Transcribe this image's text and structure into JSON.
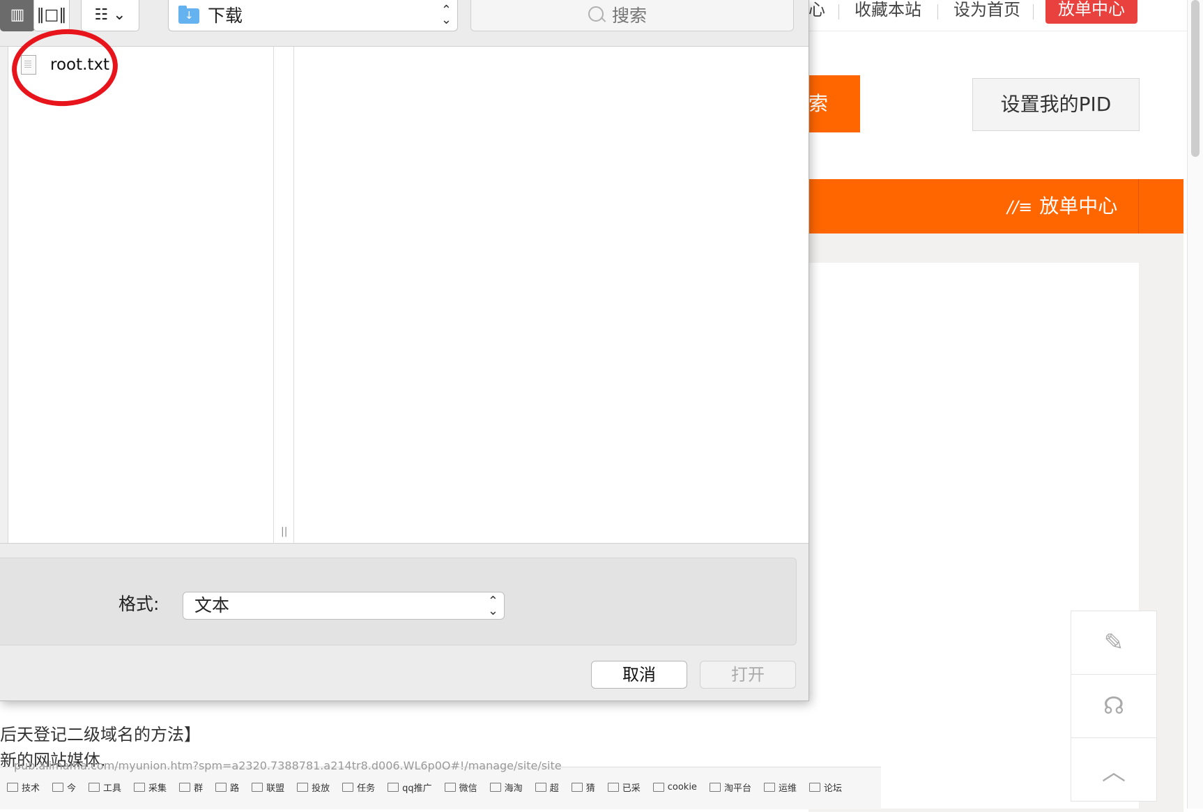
{
  "web": {
    "top_nav": [
      "心",
      "收藏本站",
      "设为首页"
    ],
    "top_red_button": "放单中心",
    "search_button_fragment": "索",
    "pid_button": "设置我的PID",
    "orange_bar_item": "放单中心",
    "bottom_lines": [
      "后天登记二级域名的方法】",
      "新的网站媒体."
    ],
    "url_text": "pub.alimama.com/myunion.htm?spm=a2320.7388781.a214tr8.d006.WL6p0O#!/manage/site/site",
    "bookmarks": [
      "技术",
      "今",
      "工具",
      "采集",
      "群",
      "路",
      "联盟",
      "投放",
      "任务",
      "qq推广",
      "微信",
      "海淘",
      "超",
      "猜",
      "已采",
      "cookie",
      "淘平台",
      "运维",
      "论坛"
    ],
    "colors": {
      "orange": "#ff6600",
      "red": "#e8413e"
    }
  },
  "dialog": {
    "location": "下载",
    "search_placeholder": "搜索",
    "files": [
      "root.txt"
    ],
    "format_label": "格式:",
    "format_value": "文本",
    "cancel_label": "取消",
    "open_label": "打开",
    "icons": [
      "column-view-icon",
      "cover-flow-icon",
      "group-icon",
      "folder-download-icon",
      "search-icon",
      "text-file-icon"
    ]
  }
}
